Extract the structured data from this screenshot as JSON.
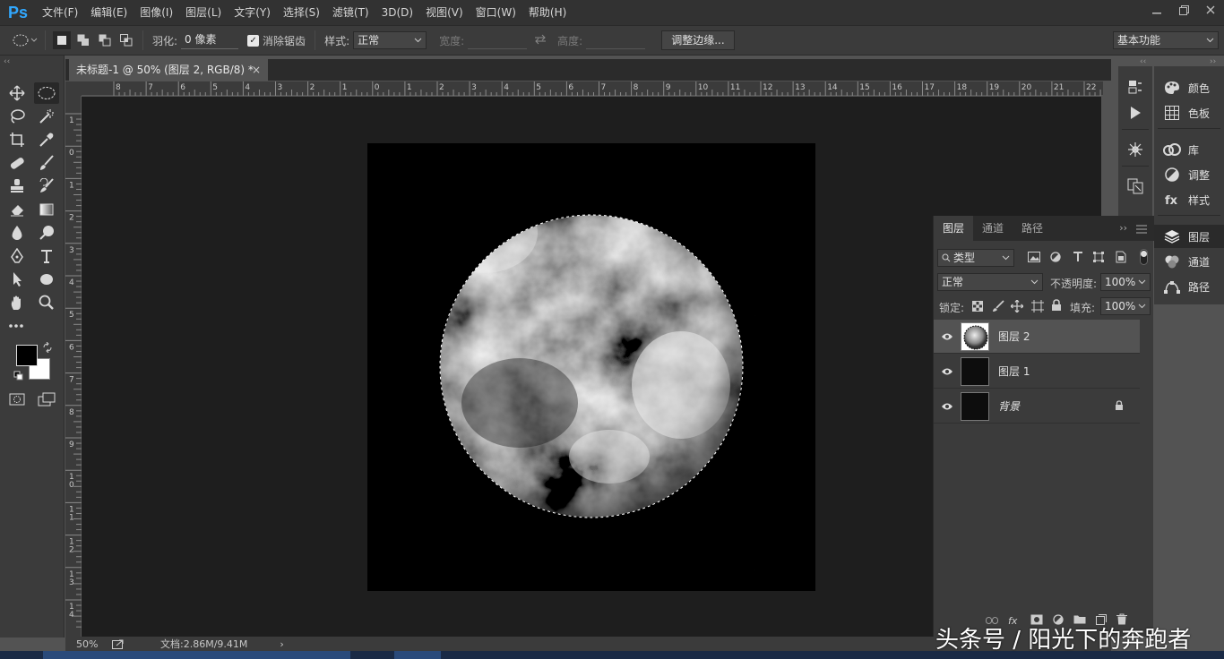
{
  "app": {
    "logo": "Ps"
  },
  "menu": [
    "文件(F)",
    "编辑(E)",
    "图像(I)",
    "图层(L)",
    "文字(Y)",
    "选择(S)",
    "滤镜(T)",
    "3D(D)",
    "视图(V)",
    "窗口(W)",
    "帮助(H)"
  ],
  "options": {
    "feather_label": "羽化:",
    "feather_value": "0 像素",
    "antialias_label": "消除锯齿",
    "style_label": "样式:",
    "style_value": "正常",
    "width_label": "宽度:",
    "height_label": "高度:",
    "refine_edge_button": "调整边缘...",
    "workspace_value": "基本功能"
  },
  "document": {
    "tab_title": "未标题-1 @ 50% (图层 2, RGB/8) *",
    "close_glyph": "×"
  },
  "ruler": {
    "top_labels": [
      "8",
      "7",
      "6",
      "5",
      "4",
      "3",
      "2",
      "1",
      "0",
      "1",
      "2",
      "3",
      "4",
      "5",
      "6",
      "7",
      "8",
      "9",
      "10",
      "11",
      "12",
      "13",
      "14",
      "15",
      "16",
      "17",
      "18",
      "19",
      "20",
      "21",
      "22"
    ],
    "left_labels": [
      "1",
      "0",
      "1",
      "2",
      "3",
      "4",
      "5",
      "6",
      "7",
      "8",
      "9",
      "1 0",
      "1 1",
      "1 2",
      "1 3",
      "1 4"
    ]
  },
  "status": {
    "zoom": "50%",
    "doc_info": "文档:2.86M/9.41M",
    "arrow": "›"
  },
  "right_panels": {
    "items": [
      {
        "label": "颜色",
        "icon": "palette-icon"
      },
      {
        "label": "色板",
        "icon": "grid-icon"
      },
      {
        "label": "库",
        "icon": "cc-library-icon"
      },
      {
        "label": "调整",
        "icon": "adjust-icon"
      },
      {
        "label": "样式",
        "icon": "style-icon"
      },
      {
        "label": "图层",
        "icon": "layers-icon"
      },
      {
        "label": "通道",
        "icon": "channels-icon"
      },
      {
        "label": "路径",
        "icon": "paths-icon"
      }
    ]
  },
  "layers_panel": {
    "tabs": [
      "图层",
      "通道",
      "路径"
    ],
    "filter_kind": "类型",
    "blend_mode": "正常",
    "opacity_label": "不透明度:",
    "opacity_value": "100%",
    "lock_label": "锁定:",
    "fill_label": "填充:",
    "fill_value": "100%",
    "layers": [
      {
        "name": "图层 2",
        "selected": true
      },
      {
        "name": "图层 1",
        "selected": false
      },
      {
        "name": "背景",
        "selected": false,
        "locked": true
      }
    ]
  },
  "watermark": "头条号 / 阳光下的奔跑者"
}
